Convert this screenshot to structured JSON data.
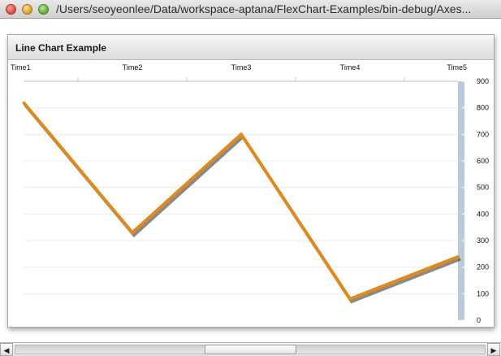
{
  "window": {
    "title": "/Users/seoyeonlee/Data/workspace-aptana/FlexChart-Examples/bin-debug/Axes..."
  },
  "panel": {
    "title": "Line Chart Example"
  },
  "scrollbar": {
    "left_arrow": "◀",
    "right_arrow": "▶"
  },
  "chart_data": {
    "type": "line",
    "title": "",
    "xlabel": "",
    "ylabel": "",
    "categories": [
      "Time1",
      "Time2",
      "Time3",
      "Time4",
      "Time5"
    ],
    "series": [
      {
        "values": [
          820,
          330,
          700,
          80,
          240
        ],
        "color": "#e08a1e"
      }
    ],
    "ylim": [
      0,
      900
    ],
    "y_ticks": [
      0,
      100,
      200,
      300,
      400,
      500,
      600,
      700,
      800,
      900
    ],
    "x_axis_position": "top",
    "y_axis_position": "right",
    "grid": true
  }
}
